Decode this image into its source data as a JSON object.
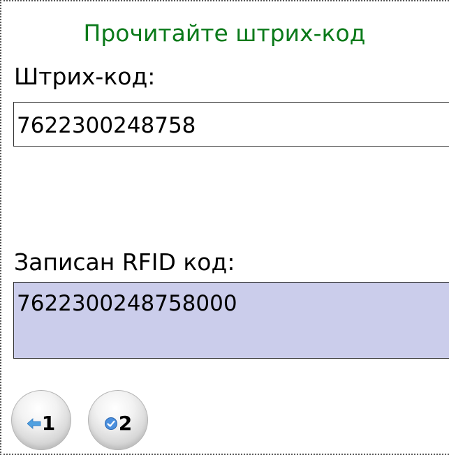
{
  "screen": {
    "title": "Прочитайте штрих-код"
  },
  "barcode": {
    "label": "Штрих-код:",
    "value": "7622300248758"
  },
  "rfid": {
    "label": "Записан RFID код:",
    "value": "7622300248758000"
  },
  "buttons": [
    {
      "icon": "back-arrow-icon",
      "label": "1"
    },
    {
      "icon": "checkmark-icon",
      "label": "2"
    }
  ],
  "colors": {
    "title": "#0a7a1a",
    "rfid_field_bg": "#cbcdeb",
    "arrow_icon": "#4fa0e0",
    "check_icon": "#3a7fd0"
  }
}
